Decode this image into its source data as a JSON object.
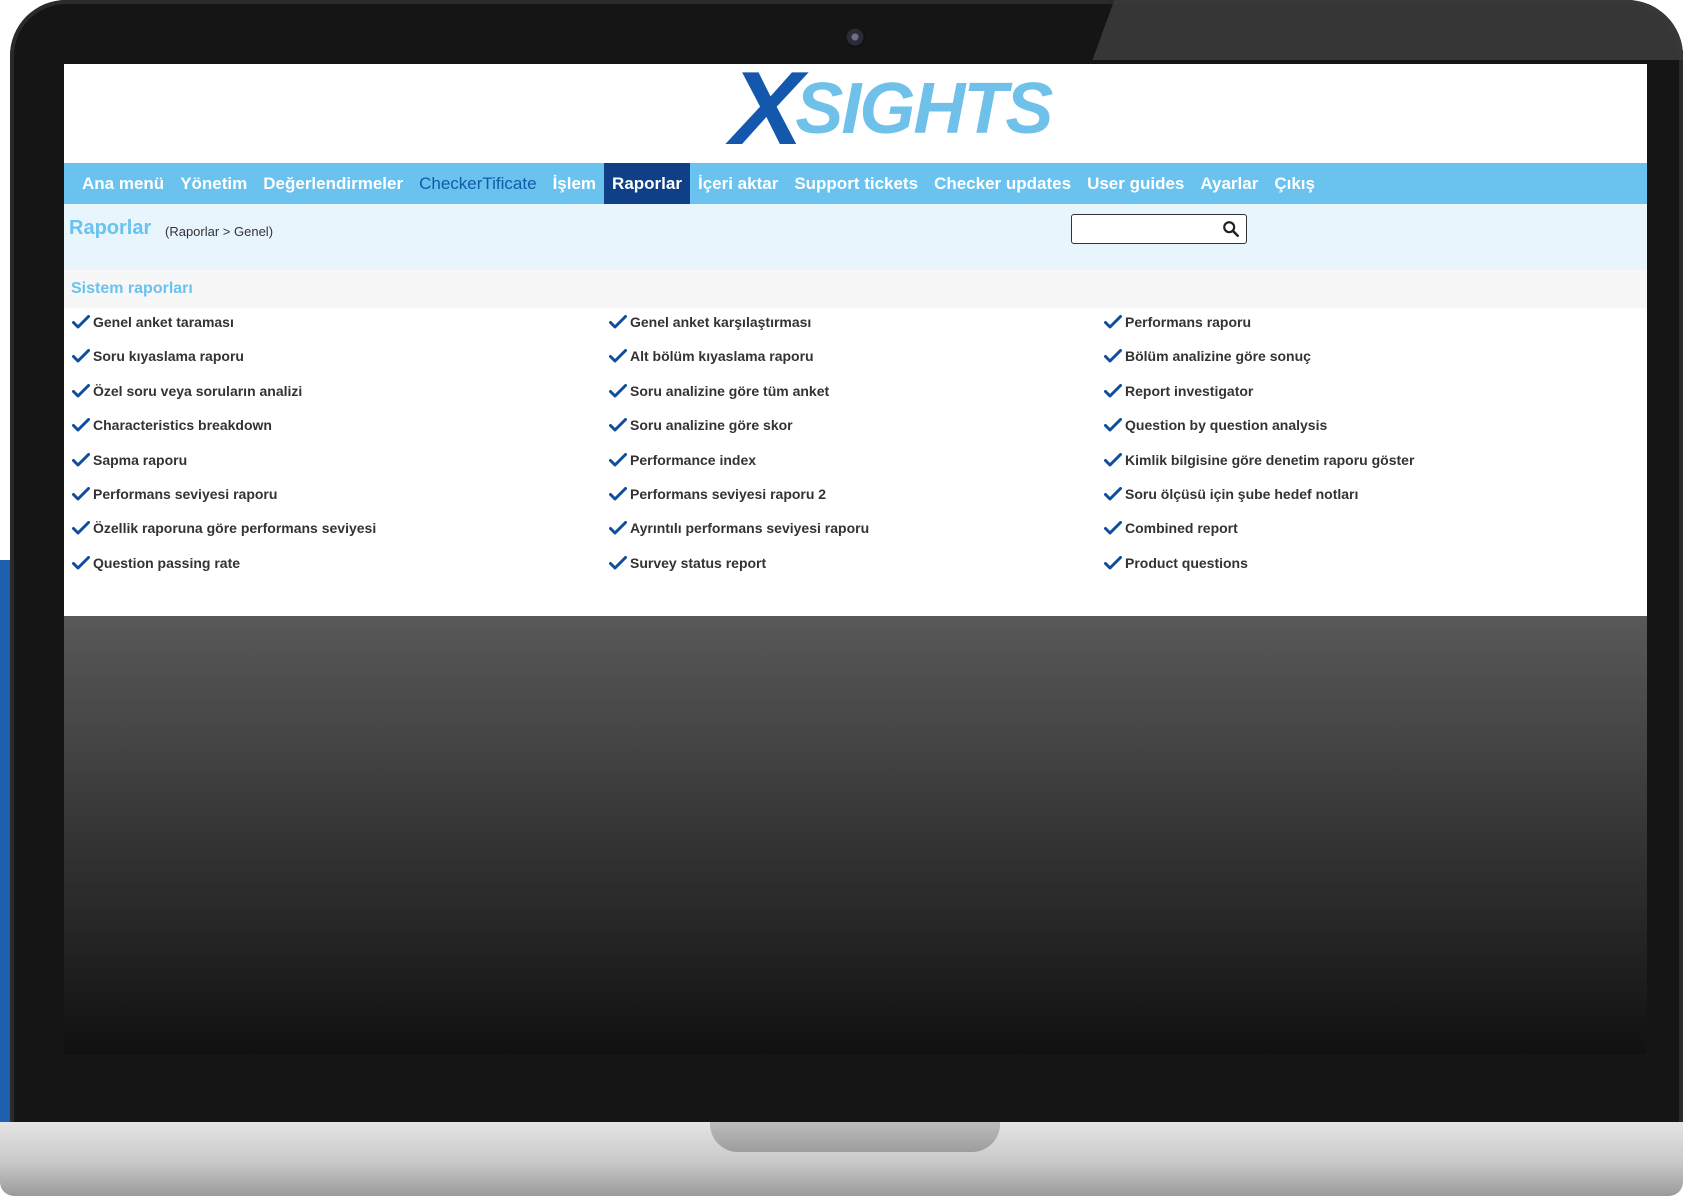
{
  "brand": {
    "logo_x": "X",
    "logo_rest": "SIGHTS"
  },
  "nav": [
    {
      "label": "Ana menü"
    },
    {
      "label": "Yönetim"
    },
    {
      "label": "Değerlendirmeler"
    },
    {
      "label": "CheckerTificate",
      "style": "alt"
    },
    {
      "label": "İşlem"
    },
    {
      "label": "Raporlar",
      "active": true
    },
    {
      "label": "İçeri aktar"
    },
    {
      "label": "Support tickets"
    },
    {
      "label": "Checker updates"
    },
    {
      "label": "User guides"
    },
    {
      "label": "Ayarlar"
    },
    {
      "label": "Çıkış"
    }
  ],
  "page": {
    "title": "Raporlar",
    "breadcrumb": "(Raporlar > Genel)"
  },
  "search": {
    "value": "",
    "placeholder": "",
    "icon": "search-icon"
  },
  "section": {
    "title": "Sistem raporları"
  },
  "reports": {
    "columns": [
      [
        "Genel anket taraması",
        "Soru kıyaslama raporu",
        "Özel soru veya soruların analizi",
        "Characteristics breakdown",
        "Sapma raporu",
        "Performans seviyesi raporu",
        "Özellik raporuna göre performans seviyesi",
        "Question passing rate"
      ],
      [
        "Genel anket karşılaştırması",
        "Alt bölüm kıyaslama raporu",
        "Soru analizine göre tüm anket",
        "Soru analizine göre skor",
        "Performance index",
        "Performans seviyesi raporu 2",
        "Ayrıntılı performans seviyesi raporu",
        "Survey status report"
      ],
      [
        "Performans raporu",
        "Bölüm analizine göre sonuç",
        "Report investigator",
        "Question by question analysis",
        "Kimlik bilgisine göre denetim raporu göster",
        "Soru ölçüsü için şube hedef notları",
        "Combined report",
        "Product questions"
      ]
    ]
  },
  "colors": {
    "nav_bg": "#6ac2ee",
    "nav_active": "#0f3f86",
    "accent": "#6ac2ee",
    "check": "#0f4d9e",
    "logo_dark": "#1458ad",
    "logo_light": "#6fc1ea"
  }
}
